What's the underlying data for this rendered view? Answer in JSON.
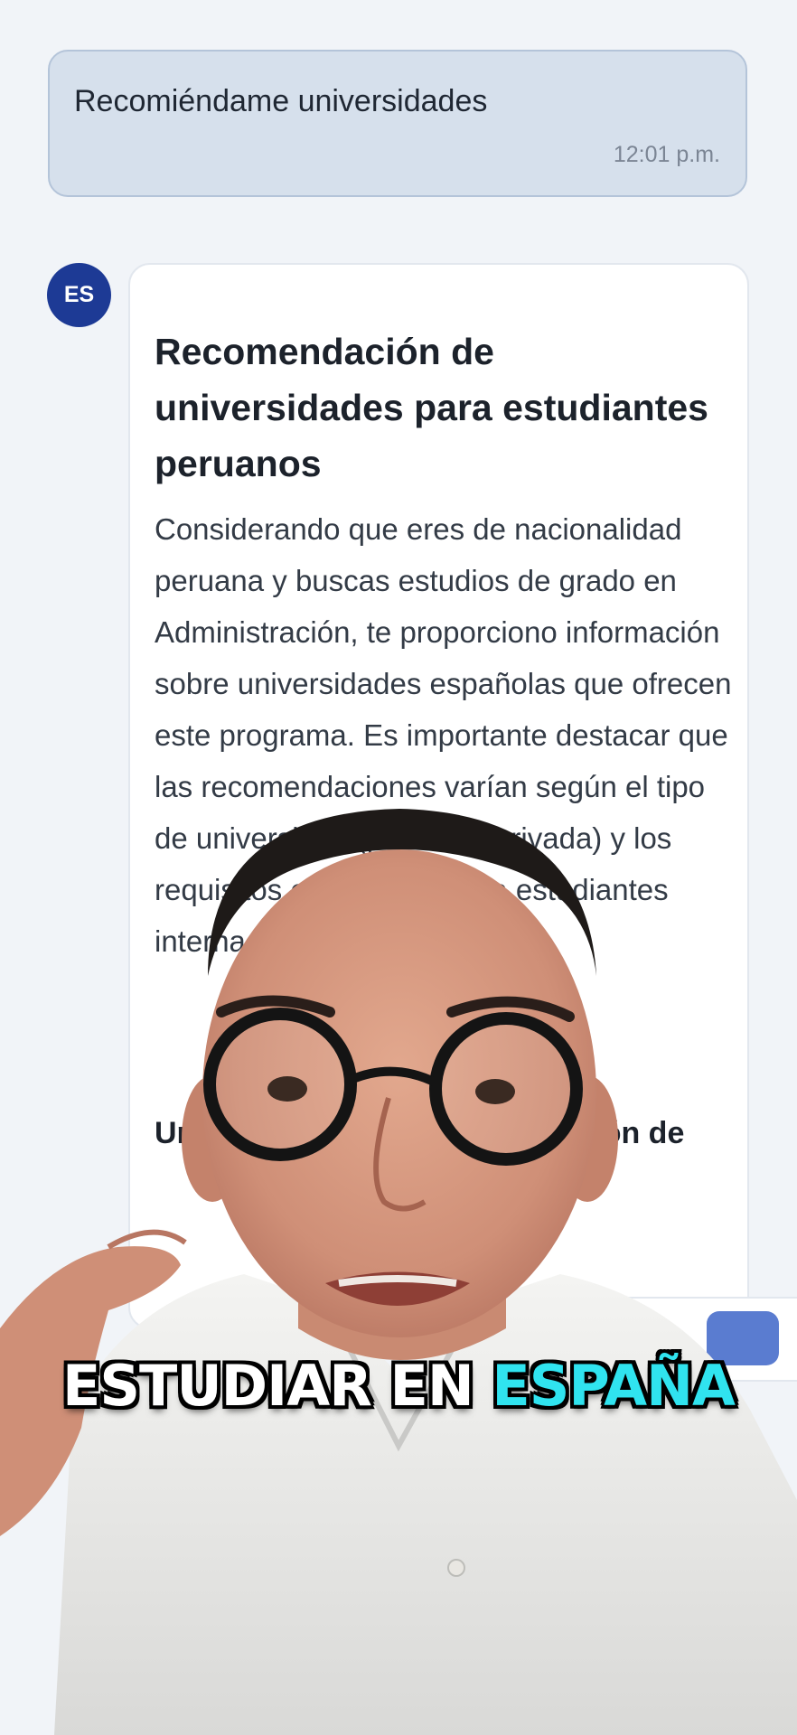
{
  "user_message": {
    "text": "Recomiéndame universidades",
    "time": "12:01 p.m."
  },
  "assistant": {
    "avatar_initials": "ES",
    "title": "Recomendación de universidades para estudiantes peruanos",
    "paragraph": "Considerando que eres de nacionalidad peruana y buscas estudios de grado en Administración, te proporciono información sobre universidades españolas que ofrecen este programa. Es importante destacar que las recomendaciones varían según el tipo de universidad (pública o privada) y los requisitos específicos para estudiantes internacionales.",
    "subheading": "Universidades de Administración de"
  },
  "caption": {
    "part1": "ESTUDIAR EN ",
    "part2": "ESPAÑA",
    "accent_color": "#30e3ef"
  },
  "colors": {
    "user_bubble": "#d6e0ec",
    "avatar": "#1d3a95",
    "background": "#f1f4f8"
  }
}
